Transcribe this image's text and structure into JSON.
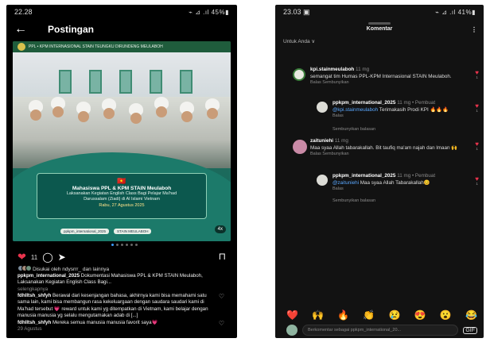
{
  "left": {
    "status_time": "22.28",
    "status_right": "⌁ ⊿ .ıl 45%▮",
    "title": "Postingan",
    "image": {
      "header_text": "PPL • KPM INTERNASIONAL STAIN TEUNGKU DIRUNDENG MEULABOH",
      "banner_title": "Mahasiswa PPL & KPM STAIN Meulaboh",
      "banner_line2": "Laksanakan Kegiatan English Class Bagi Pelajar Ma'had",
      "banner_line3": "Darussalam (Ziadi) di Al Islami Vietnam",
      "banner_date": "Rabu, 27 Agustus 2025",
      "footer_pill1": "ppkpm_international_2025",
      "footer_pill2": "STAIN MEULABOH",
      "pager": "4x"
    },
    "likes_count": "11",
    "liked_by": "Disukai oleh ndysrrr_ dan lainnya",
    "caption_user": "ppkpm_international_2025",
    "caption_text": "Dokumentasi Mahasiswa PPL & KPM STAIN Meulaboh, Laksanakan Kegiatan English Class Bagi...",
    "see_more": "selengkapnya",
    "comment1_user": "fdhlltsh_shfyh",
    "comment1_text": "Berawal dari kesenjangan bahasa, akhirnya kami bisa memahami satu sama lain, kami bisa membangun rasa kekeluargaan dengan saudara saudari kami di Ma'had tersebut 💗 reward untuk kami yg ditempatkan di Vietnam, kami belajar dengan manusia manusia yg selalu mengutamakan adab di [...]",
    "comment2_user": "fdhlltsh_shfyh",
    "comment2_text": "Mereka semua manusia manusia favorit saya💗",
    "comment2_time": "29 Agustus"
  },
  "right": {
    "status_time": "23.03 ▣",
    "status_right": "⌁ ⊿ .ıl 41%▮",
    "title": "Komentar",
    "filter": "Untuk Anda ∨",
    "comments": [
      {
        "user": "kpi.stainmeulaboh",
        "time": "11 mg",
        "text": "semangat tim Humas PPL-KPM Internasional STAIN Meulaboh.",
        "meta": "Balas    Sembunyikan",
        "likes": "1"
      },
      {
        "user": "ppkpm_international_2025",
        "time": "11 mg • Pembuat",
        "mention": "@kpi.stainmeulaboh",
        "text": "Terimakasih Prodi KPI 🔥🔥🔥",
        "meta": "Balas",
        "likes": "1"
      },
      {
        "user": "zaituniehi",
        "time": "11 mg",
        "text": "Maa syaa Allah tabarakallah. Bit taufiq ma'am najah dan lmaan 🙌",
        "meta": "Balas    Sembunyikan",
        "likes": "1"
      },
      {
        "user": "ppkpm_international_2025",
        "time": "11 mg • Pembuat",
        "mention": "@zaituniehi",
        "text": "Maa syaa Allah Tabarakallah😊",
        "meta": "Balas",
        "likes": "1"
      }
    ],
    "hide_replies": "Sembunyikan balasan",
    "emojis": [
      "❤️",
      "🙌",
      "🔥",
      "👏",
      "😢",
      "😍",
      "😮",
      "😂"
    ],
    "input_placeholder": "Berkomentar sebagai ppkpm_international_20...",
    "gif_label": "GIF"
  }
}
